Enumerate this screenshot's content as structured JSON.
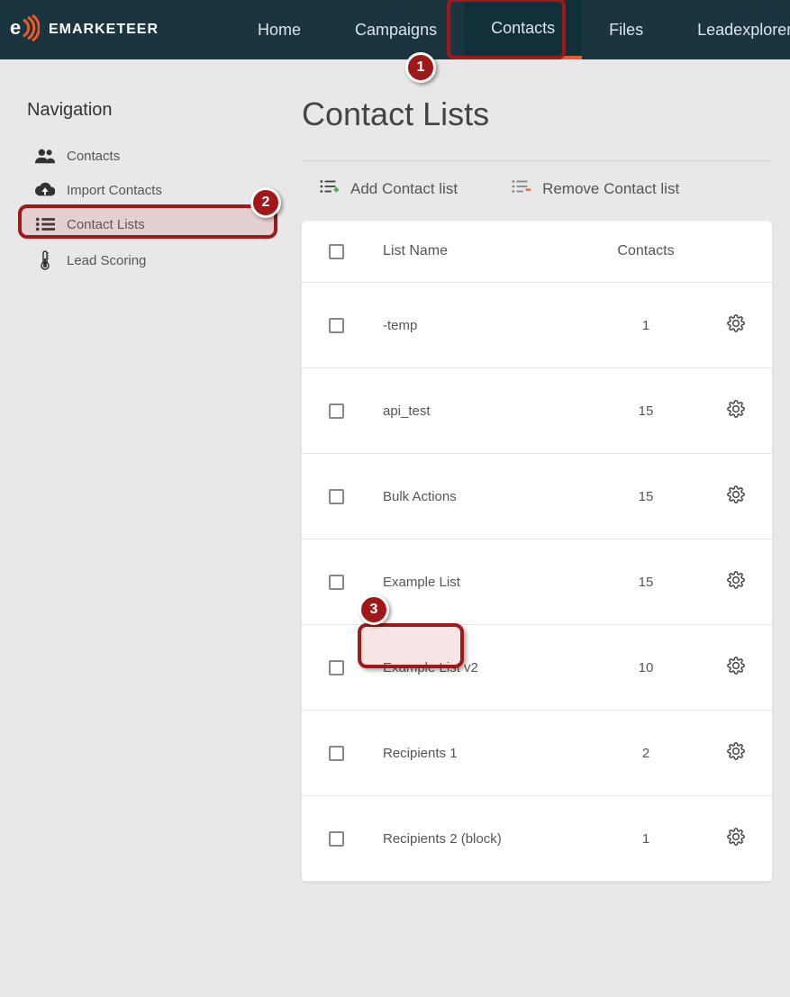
{
  "brand": "EMARKETEER",
  "nav": {
    "home": "Home",
    "campaigns": "Campaigns",
    "contacts": "Contacts",
    "files": "Files",
    "leadexplorer": "Leadexplorer"
  },
  "sidebar": {
    "title": "Navigation",
    "items": [
      {
        "label": "Contacts"
      },
      {
        "label": "Import Contacts"
      },
      {
        "label": "Contact Lists"
      },
      {
        "label": "Lead Scoring"
      }
    ]
  },
  "page": {
    "title": "Contact Lists"
  },
  "actions": {
    "add": "Add Contact list",
    "remove": "Remove Contact list"
  },
  "table": {
    "header": {
      "name": "List Name",
      "contacts": "Contacts"
    },
    "rows": [
      {
        "name": "-temp",
        "contacts": "1"
      },
      {
        "name": "api_test",
        "contacts": "15"
      },
      {
        "name": "Bulk Actions",
        "contacts": "15"
      },
      {
        "name": "Example List",
        "contacts": "15"
      },
      {
        "name": "Example List v2",
        "contacts": "10"
      },
      {
        "name": "Recipients 1",
        "contacts": "2"
      },
      {
        "name": "Recipients 2 (block)",
        "contacts": "1"
      }
    ]
  },
  "callouts": {
    "n1": "1",
    "n2": "2",
    "n3": "3"
  }
}
